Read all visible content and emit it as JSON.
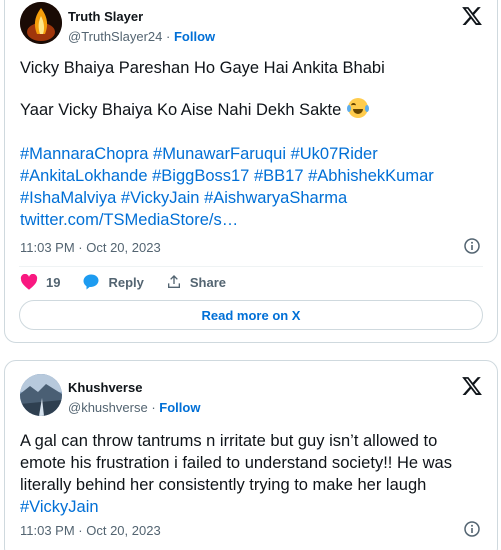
{
  "tweets": [
    {
      "author": "Truth Slayer",
      "handle": "@TruthSlayer24",
      "dot": "·",
      "follow_label": "Follow",
      "line1": "Vicky Bhaiya Pareshan Ho Gaye Hai Ankita Bhabi",
      "line2": "Yaar Vicky Bhaiya Ko Aise Nahi Dekh Sakte",
      "emoji": "face-with-tears-of-joy",
      "hashtags": [
        "#MannaraChopra",
        "#MunawarFaruqui",
        "#Uk07Rider",
        "#AnkitaLokhande",
        "#BiggBoss17",
        "#BB17",
        "#AbhishekKumar",
        "#IshaMalviya",
        "#VickyJain",
        "#AishwaryaSharma"
      ],
      "link": "twitter.com/TSMediaStore/s…",
      "timestamp": "11:03 PM · Oct 20, 2023",
      "likes": "19",
      "reply_label": "Reply",
      "share_label": "Share",
      "read_more_label": "Read more on X"
    },
    {
      "author": "Khushverse",
      "handle": "@khushverse",
      "dot": "·",
      "follow_label": "Follow",
      "text": "A gal can throw tantrums n irritate but guy isn’t allowed to emote his frustration i failed to understand society!! He was literally behind her consistently trying to make her laugh ",
      "hashtag": "#VickyJain",
      "timestamp": "11:03 PM · Oct 20, 2023"
    }
  ],
  "colors": {
    "link": "#006fd6",
    "text": "#0f1419",
    "muted": "#536471",
    "like": "#f91880",
    "border": "#cfd9de"
  }
}
